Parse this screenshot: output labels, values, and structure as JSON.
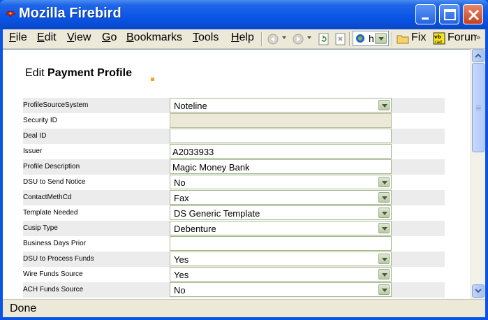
{
  "window": {
    "title": "Mozilla Firebird"
  },
  "menu": {
    "items": [
      {
        "label": "File",
        "key": "F",
        "rest": "ile"
      },
      {
        "label": "Edit",
        "key": "E",
        "rest": "dit"
      },
      {
        "label": "View",
        "key": "V",
        "rest": "iew"
      },
      {
        "label": "Go",
        "key": "G",
        "rest": "o"
      },
      {
        "label": "Bookmarks",
        "key": "B",
        "rest": "ookmarks"
      },
      {
        "label": "Tools",
        "key": "T",
        "rest": "ools"
      },
      {
        "label": "Help",
        "key": "H",
        "rest": "elp"
      }
    ]
  },
  "toolbar": {
    "url_fragment": "h",
    "bookmarks": [
      "Fix",
      "Forum"
    ],
    "icons": [
      "back-icon",
      "forward-icon",
      "reload-icon",
      "stop-icon",
      "site-icon",
      "folder-icon",
      "forum-icon",
      "overflow-icon"
    ]
  },
  "page": {
    "heading_prefix": "Edit",
    "heading_bold": "Payment Profile"
  },
  "form": {
    "rows": [
      {
        "label": "ProfileSourceSystem",
        "type": "select",
        "value": "Noteline"
      },
      {
        "label": "Security ID",
        "type": "text-disabled",
        "value": ""
      },
      {
        "label": "Deal ID",
        "type": "text",
        "value": ""
      },
      {
        "label": "Issuer",
        "type": "text",
        "value": "A2033933"
      },
      {
        "label": "Profile Description",
        "type": "text",
        "value": "Magic Money Bank"
      },
      {
        "label": "DSU to Send Notice",
        "type": "select",
        "value": "No"
      },
      {
        "label": "ContactMethCd",
        "type": "select",
        "value": "Fax"
      },
      {
        "label": "Template Needed",
        "type": "select",
        "value": "DS Generic Template"
      },
      {
        "label": "Cusip Type",
        "type": "select",
        "value": "Debenture"
      },
      {
        "label": "Business Days Prior",
        "type": "text",
        "value": ""
      },
      {
        "label": "DSU to Process Funds",
        "type": "select",
        "value": "Yes"
      },
      {
        "label": "Wire Funds Source",
        "type": "select",
        "value": "Yes"
      },
      {
        "label": "ACH Funds Source",
        "type": "select",
        "value": "No"
      }
    ]
  },
  "status": {
    "text": "Done"
  },
  "colors": {
    "title_blue": "#0a55e6",
    "chrome": "#ece9d8",
    "field_border": "#a5b98c",
    "row_shade": "#ececec",
    "accent_orange": "#f5a320"
  }
}
